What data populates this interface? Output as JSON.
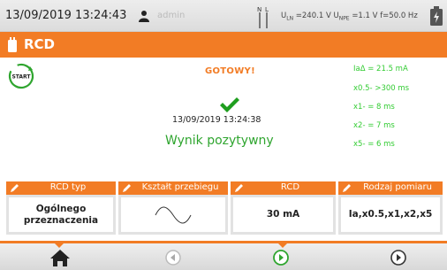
{
  "statusbar": {
    "datetime": "13/09/2019 13:24:43",
    "user": "admin",
    "plug_letters": {
      "n": "N",
      "l": "L"
    },
    "readings": {
      "uln_label": "U",
      "uln_sub": "LN",
      "uln_value": "=240.1 V",
      "upe_label": "U",
      "upe_sub": "NPE",
      "upe_value": "=1.1 V",
      "freq": "f=50.0 Hz"
    },
    "icons": {
      "user": "user-icon",
      "plug": "plug-icon",
      "battery": "battery-icon"
    }
  },
  "title": {
    "text": "RCD",
    "icon": "rcd-device-icon"
  },
  "main": {
    "start_label": "START",
    "status": "GOTOWY!",
    "timestamp": "13/09/2019 13:24:38",
    "verdict": "Wynik pozytywny",
    "results": [
      "IaΔ = 21.5 mA",
      "x0.5- >300 ms",
      "x1- = 8 ms",
      "x2- = 7 ms",
      "x5- = 6 ms"
    ]
  },
  "cards": [
    {
      "header": "RCD typ",
      "value_line1": "Ogólnego",
      "value_line2": "przeznaczenia"
    },
    {
      "header": "Kształt przebiegu",
      "value_icon": "sine-wave-icon"
    },
    {
      "header": "RCD",
      "value": "30 mA"
    },
    {
      "header": "Rodzaj pomiaru",
      "value": "Ia,x0.5,x1,x2,x5"
    }
  ],
  "nav": {
    "home": "home-icon",
    "back": "back-arrow-icon",
    "play": "play-icon",
    "next": "next-arrow-icon"
  },
  "colors": {
    "accent": "#f27c25",
    "ok": "#2fa52f",
    "result": "#33cc33"
  }
}
